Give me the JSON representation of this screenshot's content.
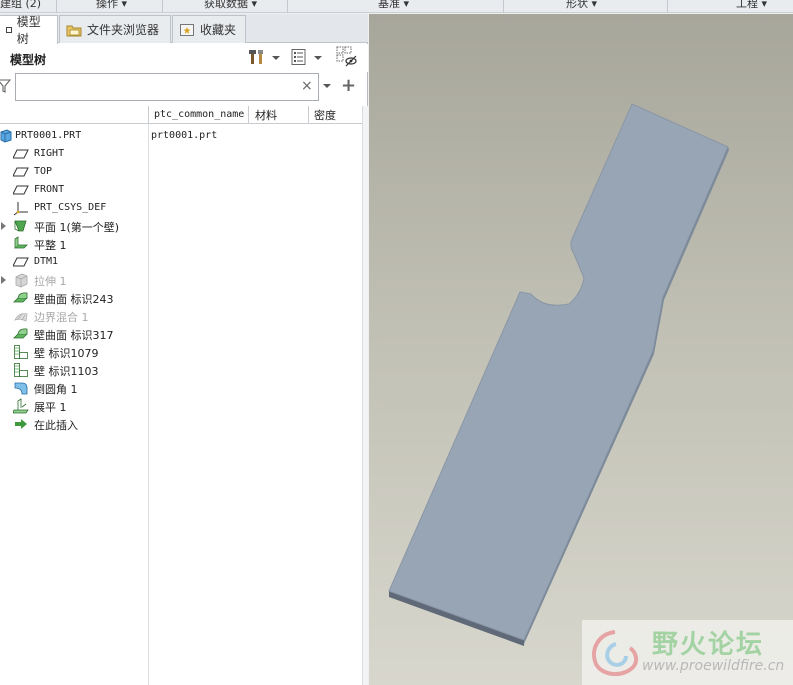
{
  "ribbon": {
    "groups": [
      "建组 (2)",
      "操作",
      "获取数据",
      "基准",
      "形状",
      "工程"
    ]
  },
  "tabs": {
    "model_tree": "模型树",
    "folder_browser": "文件夹浏览器",
    "favorites": "收藏夹"
  },
  "tree_panel": {
    "title": "模型树",
    "filter_placeholder": "",
    "filter_clear": "×",
    "filter_add": "+"
  },
  "columns": {
    "common_name": "ptc_common_name",
    "material": "材料",
    "density": "密度"
  },
  "tree": {
    "items": [
      {
        "label": "PRT0001.PRT",
        "icon": "part-icon",
        "common_name": "prt0001.prt"
      },
      {
        "label": "RIGHT",
        "icon": "datum-plane-icon"
      },
      {
        "label": "TOP",
        "icon": "datum-plane-icon"
      },
      {
        "label": "FRONT",
        "icon": "datum-plane-icon"
      },
      {
        "label": "PRT_CSYS_DEF",
        "icon": "csys-icon"
      },
      {
        "label": "平面 1(第一个壁)",
        "icon": "planar-wall-icon"
      },
      {
        "label": "平整 1",
        "icon": "flat-wall-icon"
      },
      {
        "label": "DTM1",
        "icon": "datum-plane-icon"
      },
      {
        "label": "拉伸 1",
        "icon": "extrude-icon"
      },
      {
        "label": "壁曲面 标识243",
        "icon": "wall-surface-icon"
      },
      {
        "label": "边界混合 1",
        "icon": "boundary-blend-icon"
      },
      {
        "label": "壁曲面 标识317",
        "icon": "wall-surface-icon"
      },
      {
        "label": "壁 标识1079",
        "icon": "wall-icon"
      },
      {
        "label": "壁 标识1103",
        "icon": "wall-icon"
      },
      {
        "label": "倒圆角 1",
        "icon": "round-icon"
      },
      {
        "label": "展平 1",
        "icon": "unbend-icon"
      },
      {
        "label": "在此插入",
        "icon": "insert-here-icon"
      }
    ]
  },
  "watermark": {
    "title": "野火论坛",
    "url": "www.proewildfire.cn"
  },
  "colors": {
    "part_face": "#98a5b5",
    "part_edge": "#5f6977",
    "accent_green": "#3d9b3d"
  }
}
